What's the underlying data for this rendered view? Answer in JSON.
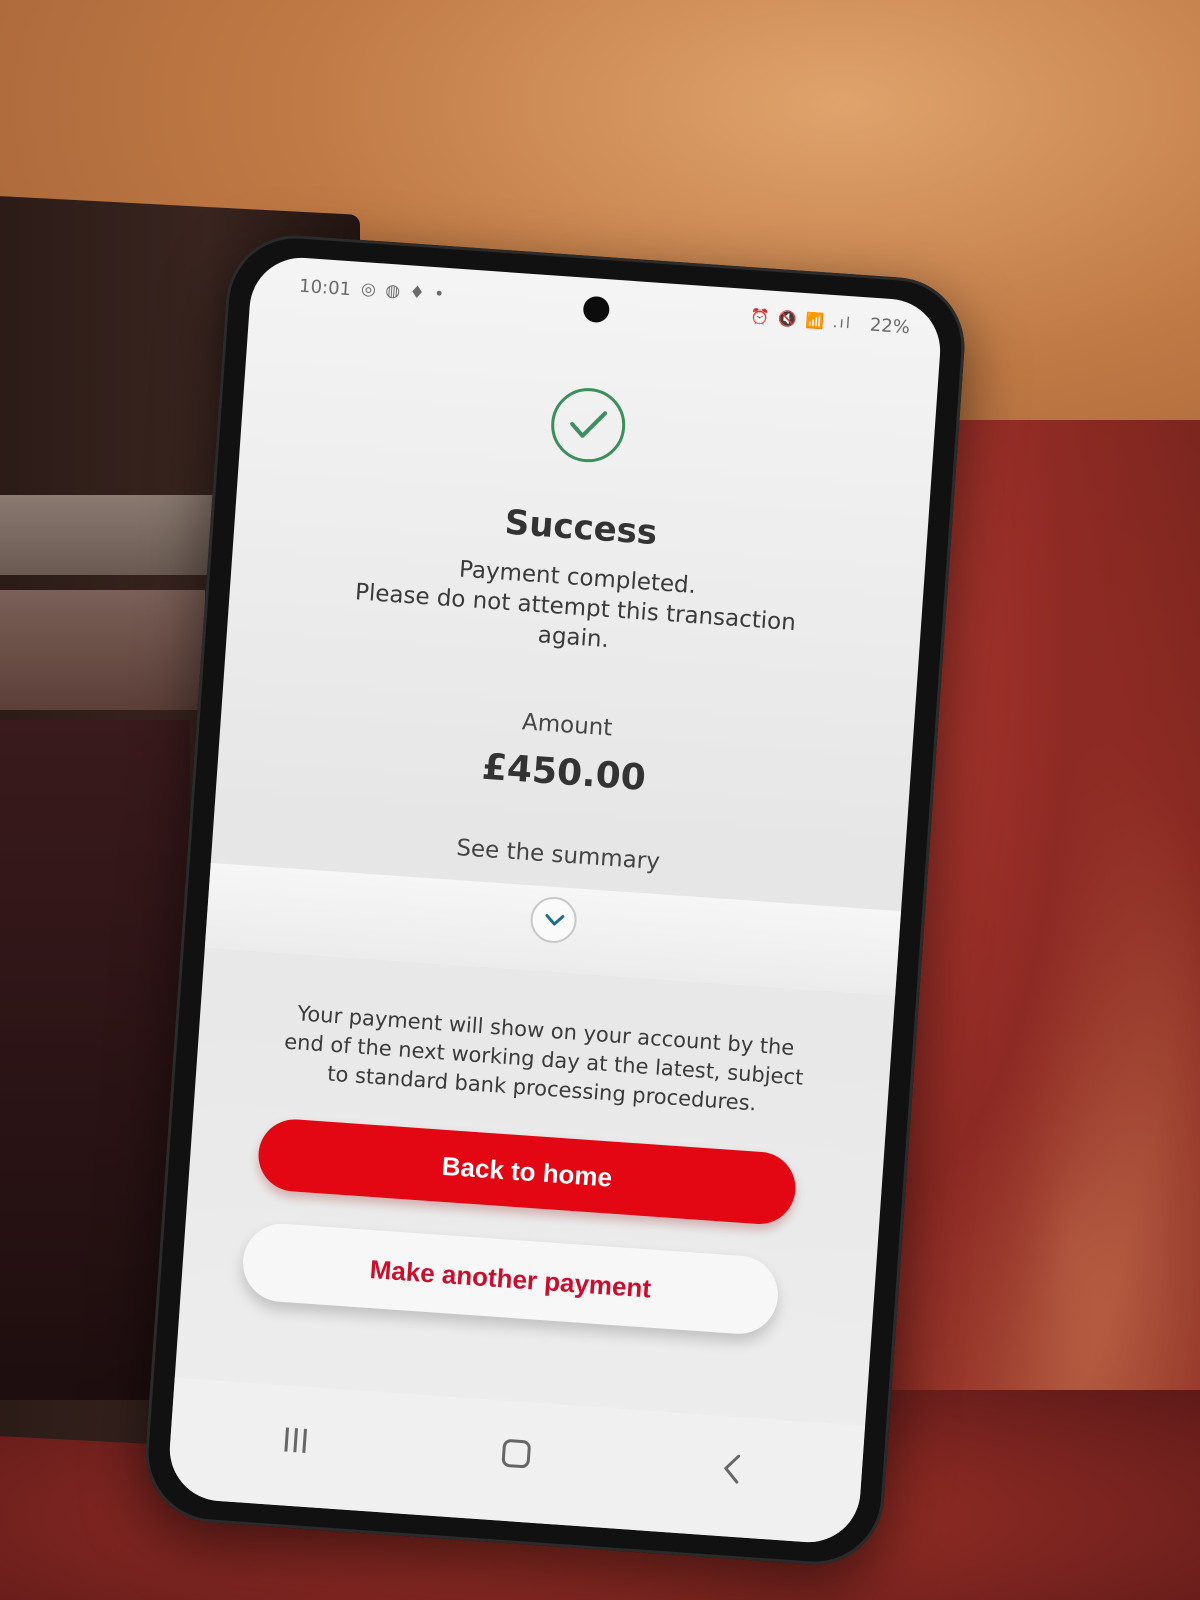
{
  "status_bar": {
    "time": "10:01",
    "left_icons": "◎ ◍ ♦ •",
    "right_icons": "⏰ 🔇 📶 .ıl",
    "battery": "22%"
  },
  "result": {
    "icon": "check-circle-icon",
    "title": "Success",
    "message_lines": [
      "Payment completed.",
      "Please do not attempt this transaction",
      "again."
    ]
  },
  "amount": {
    "label": "Amount",
    "value": "£450.00"
  },
  "summary": {
    "link_label": "See the summary",
    "expand_icon": "chevron-down-icon"
  },
  "info": {
    "lines": [
      "Your payment will show on your account by the",
      "end of the next working day at the latest, subject",
      "to standard bank processing procedures."
    ]
  },
  "actions": {
    "primary_label": "Back to home",
    "secondary_label": "Make another payment"
  },
  "nav": {
    "recent_icon": "recent-apps-icon",
    "home_icon": "home-icon",
    "back_icon": "back-icon"
  },
  "colors": {
    "brand_red": "#e30613",
    "success_green": "#3a8f5a",
    "secondary_text_red": "#c8102e"
  }
}
